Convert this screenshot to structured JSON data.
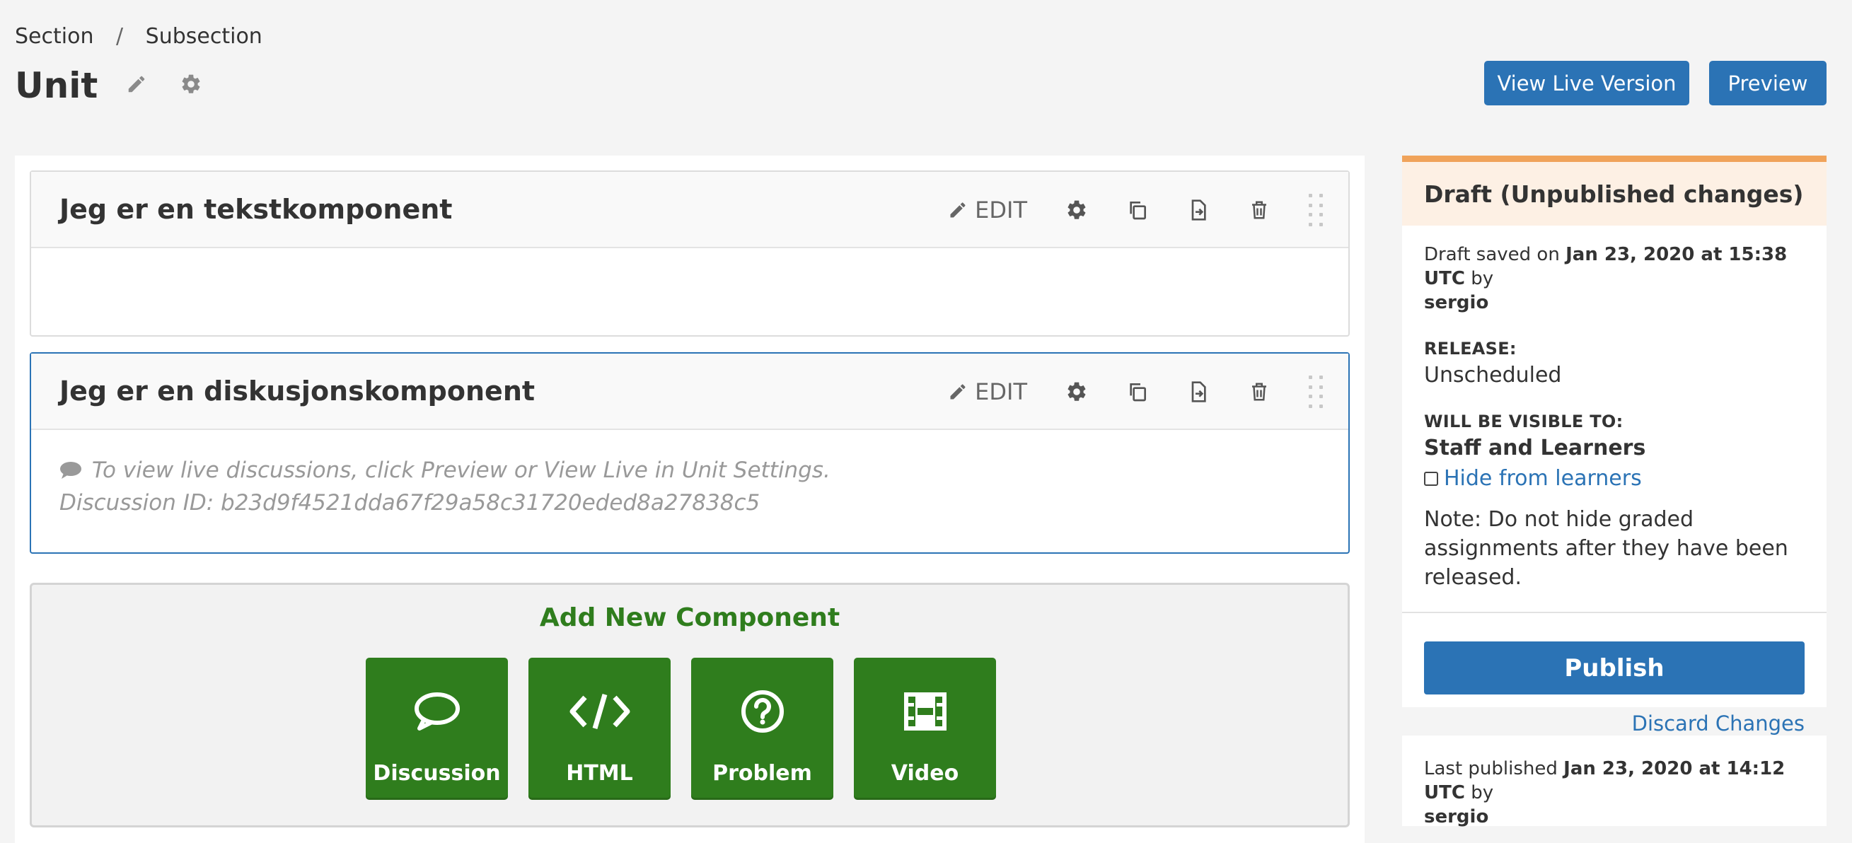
{
  "breadcrumb": {
    "section": "Section",
    "separator": "/",
    "subsection": "Subsection"
  },
  "page": {
    "title": "Unit"
  },
  "header_buttons": {
    "view_live": "View Live Version",
    "preview": "Preview"
  },
  "components": [
    {
      "title": "Jeg er en tekstkomponent",
      "edit_label": "EDIT"
    },
    {
      "title": "Jeg er en diskusjonskomponent",
      "edit_label": "EDIT",
      "body_line1": "To view live discussions, click Preview or View Live in Unit Settings.",
      "body_line2": "Discussion ID: b23d9f4521dda67f29a58c31720eded8a27838c5"
    }
  ],
  "add_new": {
    "title": "Add New Component",
    "buttons": [
      {
        "label": "Discussion",
        "icon": "speech-bubble-icon"
      },
      {
        "label": "HTML",
        "icon": "code-icon"
      },
      {
        "label": "Problem",
        "icon": "question-circle-icon"
      },
      {
        "label": "Video",
        "icon": "film-icon"
      }
    ]
  },
  "sidebar": {
    "status_title": "Draft (Unpublished changes)",
    "draft_saved_prefix": "Draft saved on",
    "draft_saved_date": "Jan 23, 2020 at 15:38 UTC",
    "draft_saved_by": "by",
    "draft_saved_user": "sergio",
    "release_label": "RELEASE:",
    "release_value": "Unscheduled",
    "visible_label": "WILL BE VISIBLE TO:",
    "visible_value": "Staff and Learners",
    "hide_label": "Hide from learners",
    "note": "Note: Do not hide graded assignments after they have been released.",
    "publish_label": "Publish",
    "discard_label": "Discard Changes",
    "last_published_prefix": "Last published",
    "last_published_date": "Jan 23, 2020 at 14:12 UTC",
    "last_published_by": "by",
    "last_published_user": "sergio"
  },
  "colors": {
    "primary": "#2b73b5",
    "add_green": "#2f7d1d",
    "draft_accent": "#f0a35a",
    "draft_bg": "#fdf0e4"
  }
}
